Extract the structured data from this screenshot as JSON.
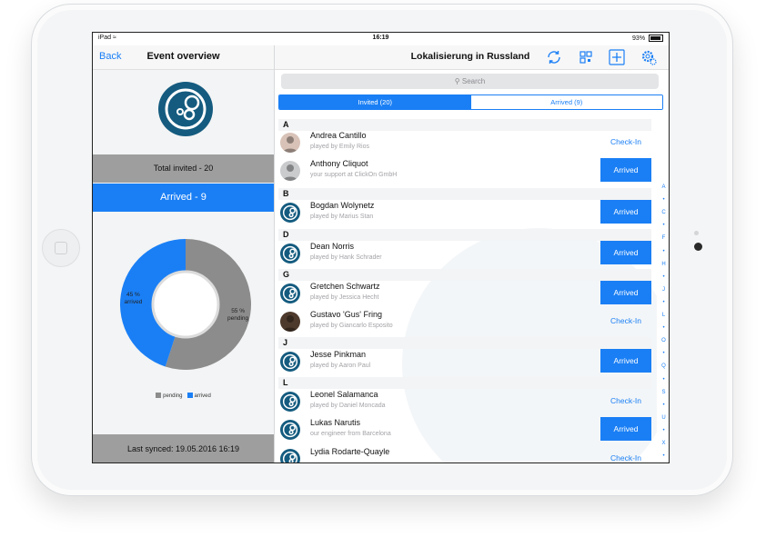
{
  "status_bar": {
    "device": "iPad",
    "time": "16:19",
    "battery": "93%"
  },
  "left_panel": {
    "back_label": "Back",
    "title": "Event overview",
    "total_invited": "Total invited - 20",
    "arrived": "Arrived - 9",
    "last_synced": "Last synced: 19.05.2016 16:19"
  },
  "chart_data": {
    "type": "pie",
    "categories": [
      "pending",
      "arrived"
    ],
    "values": [
      55,
      45
    ],
    "labels": [
      "55 %\npending",
      "45 %\narrived"
    ],
    "colors": [
      "#8c8c8c",
      "#1a7ff5"
    ],
    "legend": "bottom"
  },
  "right_panel": {
    "title": "Lokalisierung in Russland",
    "search_placeholder": "Search",
    "tabs": [
      {
        "label": "Invited (20)",
        "selected": true
      },
      {
        "label": "Arrived (9)",
        "selected": false
      }
    ],
    "sections": [
      {
        "letter": "A",
        "people": [
          {
            "name": "Andrea Cantillo",
            "sub": "played by Emily Rios",
            "status": "Check-In",
            "avatar": "photo-f"
          },
          {
            "name": "Anthony Cliquot",
            "sub": "your support at ClickOn GmbH",
            "status": "Arrived",
            "avatar": "photo-m"
          }
        ]
      },
      {
        "letter": "B",
        "people": [
          {
            "name": "Bogdan Wolynetz",
            "sub": "played by Marius Stan",
            "status": "Arrived",
            "avatar": "logo"
          }
        ]
      },
      {
        "letter": "D",
        "people": [
          {
            "name": "Dean Norris",
            "sub": "played by Hank Schrader",
            "status": "Arrived",
            "avatar": "logo"
          }
        ]
      },
      {
        "letter": "G",
        "people": [
          {
            "name": "Gretchen Schwartz",
            "sub": "played by Jessica Hecht",
            "status": "Arrived",
            "avatar": "logo"
          },
          {
            "name": "Gustavo 'Gus' Fring",
            "sub": "played by Giancarlo Esposito",
            "status": "Check-In",
            "avatar": "photo-d"
          }
        ]
      },
      {
        "letter": "J",
        "people": [
          {
            "name": "Jesse Pinkman",
            "sub": "played by Aaron Paul",
            "status": "Arrived",
            "avatar": "logo"
          }
        ]
      },
      {
        "letter": "L",
        "people": [
          {
            "name": "Leonel Salamanca",
            "sub": "played by Daniel Moncada",
            "status": "Check-In",
            "avatar": "logo"
          },
          {
            "name": "Lukas Narutis",
            "sub": "our engineer from Barcelona",
            "status": "Arrived",
            "avatar": "logo"
          },
          {
            "name": "Lydia Rodarte-Quayle",
            "sub": "",
            "status": "Check-In",
            "avatar": "logo"
          }
        ]
      }
    ],
    "index_letters": [
      "A",
      "•",
      "C",
      "•",
      "F",
      "•",
      "H",
      "•",
      "J",
      "•",
      "L",
      "•",
      "O",
      "•",
      "Q",
      "•",
      "S",
      "•",
      "U",
      "•",
      "X",
      "•",
      "Z",
      "#"
    ]
  },
  "icons": {
    "sync": "sync-icon",
    "qr": "qr-code-icon",
    "add": "add-icon",
    "settings": "settings-icon",
    "search": "search-icon",
    "wifi": "wifi-icon",
    "battery": "battery-icon",
    "logo": "event-logo-icon"
  },
  "colors": {
    "accent": "#1a7ff5",
    "logo": "#145b7f",
    "gray_bar": "#9e9e9e"
  }
}
